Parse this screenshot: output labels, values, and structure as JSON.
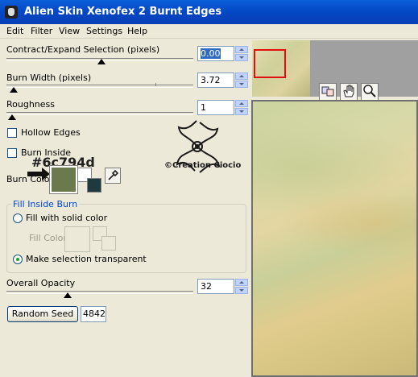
{
  "window": {
    "title": "Alien Skin Xenofex 2 Burnt Edges"
  },
  "menu": [
    "Edit",
    "Filter",
    "View",
    "Settings",
    "Help"
  ],
  "contract": {
    "label": "Contract/Expand Selection (pixels)",
    "value": "0.00"
  },
  "burn_width": {
    "label": "Burn Width (pixels)",
    "value": "3.72"
  },
  "roughness": {
    "label": "Roughness",
    "value": "1"
  },
  "hollow_edges": {
    "label": "Hollow Edges",
    "checked": false
  },
  "burn_inside": {
    "label": "Burn Inside",
    "checked": false
  },
  "burn_color": {
    "label": "Burn Color",
    "color": "#6c794d",
    "annotation": "#6c794d"
  },
  "watermark": {
    "text": "©Creation Ciocio"
  },
  "fill_inside_burn": {
    "legend": "Fill Inside Burn",
    "option_solid": "Fill with solid color",
    "fill_color_label": "Fill Color",
    "option_transparent": "Make selection transparent",
    "selected": "transparent"
  },
  "overall_opacity": {
    "label": "Overall Opacity",
    "value": "32"
  },
  "random_seed": {
    "button_label": "Random Seed",
    "value": "4842"
  },
  "colors": {
    "titlebar": "#0a5fd8",
    "accent_green": "#6c794d",
    "selection_red": "#e01010"
  },
  "tools": [
    "hand-icon",
    "zoom-icon",
    "preview-toggle-icon"
  ]
}
